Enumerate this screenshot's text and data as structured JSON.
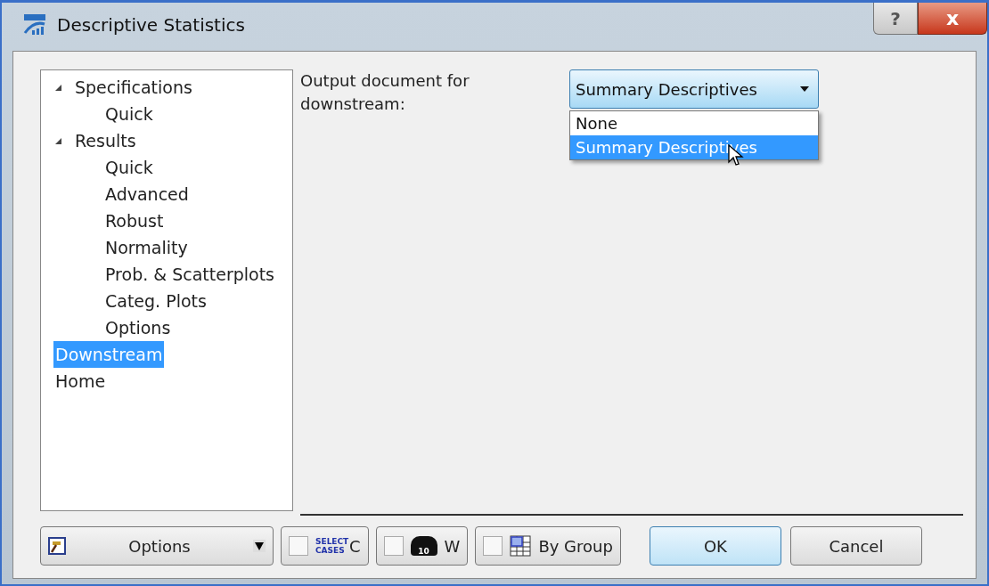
{
  "window": {
    "title": "Descriptive Statistics",
    "help": "?",
    "close": "x"
  },
  "tree": [
    {
      "label": "Specifications",
      "expanded": true,
      "selected": false,
      "children": [
        {
          "label": "Quick",
          "selected": false
        }
      ]
    },
    {
      "label": "Results",
      "expanded": true,
      "selected": false,
      "children": [
        {
          "label": "Quick",
          "selected": false
        },
        {
          "label": "Advanced",
          "selected": false
        },
        {
          "label": "Robust",
          "selected": false
        },
        {
          "label": "Normality",
          "selected": false
        },
        {
          "label": "Prob. & Scatterplots",
          "selected": false
        },
        {
          "label": "Categ. Plots",
          "selected": false
        },
        {
          "label": "Options",
          "selected": false
        }
      ]
    },
    {
      "label": "Downstream",
      "selected": true
    },
    {
      "label": "Home",
      "selected": false
    }
  ],
  "output": {
    "label": "Output document for downstream:",
    "value": "Summary Descriptives",
    "open": true,
    "options": [
      {
        "label": "None",
        "selected": false
      },
      {
        "label": "Summary Descriptives",
        "selected": true
      }
    ]
  },
  "buttons": [
    {
      "kind": "menu",
      "label": "Options"
    },
    {
      "kind": "cases",
      "checked": false,
      "icon_text": "SELECT CASES",
      "label": "C"
    },
    {
      "kind": "weight",
      "checked": false,
      "icon_text": "10",
      "label": "W"
    },
    {
      "kind": "group",
      "checked": false,
      "label": "By Group"
    },
    {
      "kind": "ok",
      "label": "OK"
    },
    {
      "kind": "plain",
      "label": "Cancel"
    }
  ]
}
